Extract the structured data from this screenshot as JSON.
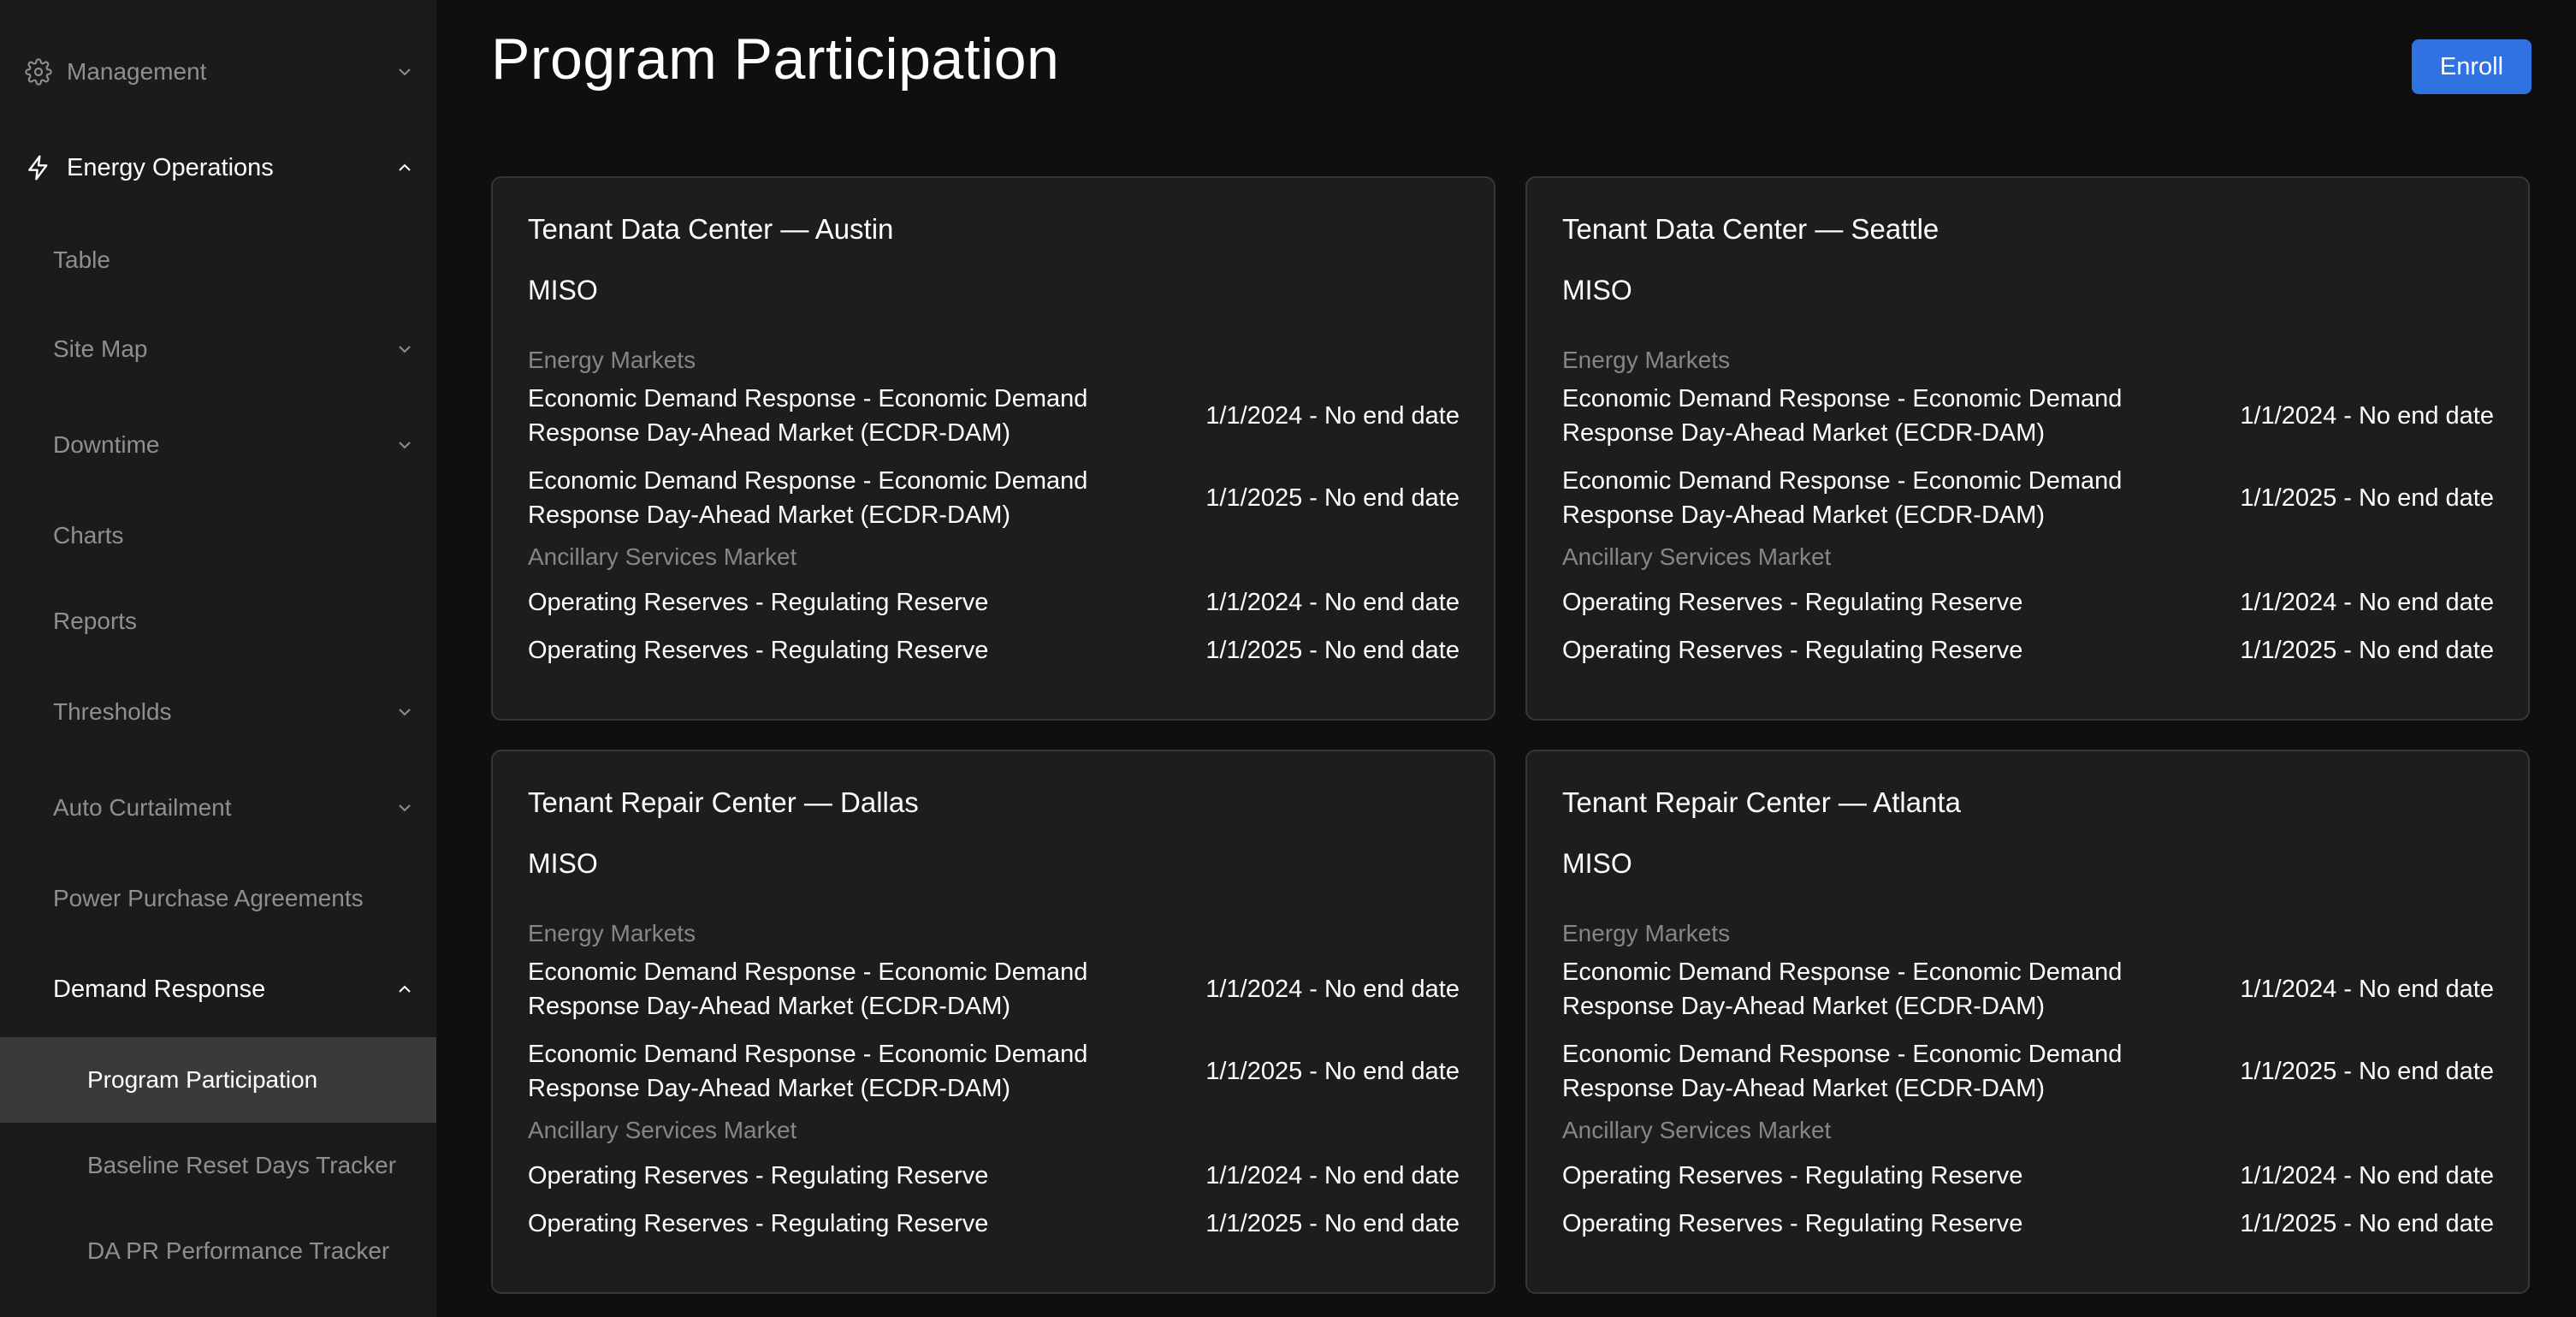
{
  "sidebar": {
    "items": [
      {
        "label": "Management",
        "icon": "gear-icon",
        "chevron": "down"
      },
      {
        "label": "Energy Operations",
        "icon": "lightning-icon",
        "chevron": "up"
      },
      {
        "label": "Table"
      },
      {
        "label": "Site Map",
        "chevron": "down"
      },
      {
        "label": "Downtime",
        "chevron": "down"
      },
      {
        "label": "Charts"
      },
      {
        "label": "Reports"
      },
      {
        "label": "Thresholds",
        "chevron": "down"
      },
      {
        "label": "Auto Curtailment",
        "chevron": "down"
      },
      {
        "label": "Power Purchase Agreements"
      },
      {
        "label": "Demand Response",
        "chevron": "up"
      },
      {
        "label": "Program Participation"
      },
      {
        "label": "Baseline Reset Days Tracker"
      },
      {
        "label": "DA PR Performance Tracker"
      }
    ]
  },
  "header": {
    "title": "Program Participation",
    "enroll_label": "Enroll"
  },
  "cards": [
    {
      "title": "Tenant Data Center — Austin",
      "iso": "MISO",
      "energy_label": "Energy Markets",
      "energy": [
        {
          "program": "Economic Demand Response - Economic Demand Response Day-Ahead Market (ECDR-DAM)",
          "dates": "1/1/2024 - No end date"
        },
        {
          "program": "Economic Demand Response - Economic Demand Response Day-Ahead Market (ECDR-DAM)",
          "dates": "1/1/2025 - No end date"
        }
      ],
      "ancillary_label": "Ancillary Services Market",
      "ancillary": [
        {
          "program": "Operating Reserves - Regulating Reserve",
          "dates": "1/1/2024 - No end date"
        },
        {
          "program": "Operating Reserves - Regulating Reserve",
          "dates": "1/1/2025 - No end date"
        }
      ]
    },
    {
      "title": "Tenant Data Center — Seattle",
      "iso": "MISO",
      "energy_label": "Energy Markets",
      "energy": [
        {
          "program": "Economic Demand Response - Economic Demand Response Day-Ahead Market (ECDR-DAM)",
          "dates": "1/1/2024 - No end date"
        },
        {
          "program": "Economic Demand Response - Economic Demand Response Day-Ahead Market (ECDR-DAM)",
          "dates": "1/1/2025 - No end date"
        }
      ],
      "ancillary_label": "Ancillary Services Market",
      "ancillary": [
        {
          "program": "Operating Reserves - Regulating Reserve",
          "dates": "1/1/2024 - No end date"
        },
        {
          "program": "Operating Reserves - Regulating Reserve",
          "dates": "1/1/2025 - No end date"
        }
      ]
    },
    {
      "title": "Tenant Repair Center — Dallas",
      "iso": "MISO",
      "energy_label": "Energy Markets",
      "energy": [
        {
          "program": "Economic Demand Response - Economic Demand Response Day-Ahead Market (ECDR-DAM)",
          "dates": "1/1/2024 - No end date"
        },
        {
          "program": "Economic Demand Response - Economic Demand Response Day-Ahead Market (ECDR-DAM)",
          "dates": "1/1/2025 - No end date"
        }
      ],
      "ancillary_label": "Ancillary Services Market",
      "ancillary": [
        {
          "program": "Operating Reserves - Regulating Reserve",
          "dates": "1/1/2024 - No end date"
        },
        {
          "program": "Operating Reserves - Regulating Reserve",
          "dates": "1/1/2025 - No end date"
        }
      ]
    },
    {
      "title": "Tenant Repair Center — Atlanta",
      "iso": "MISO",
      "energy_label": "Energy Markets",
      "energy": [
        {
          "program": "Economic Demand Response - Economic Demand Response Day-Ahead Market (ECDR-DAM)",
          "dates": "1/1/2024 - No end date"
        },
        {
          "program": "Economic Demand Response - Economic Demand Response Day-Ahead Market (ECDR-DAM)",
          "dates": "1/1/2025 - No end date"
        }
      ],
      "ancillary_label": "Ancillary Services Market",
      "ancillary": [
        {
          "program": "Operating Reserves - Regulating Reserve",
          "dates": "1/1/2024 - No end date"
        },
        {
          "program": "Operating Reserves - Regulating Reserve",
          "dates": "1/1/2025 - No end date"
        }
      ]
    }
  ],
  "colors": {
    "accent": "#3172e3",
    "sidebar_bg": "#1b1b1b",
    "selected_bg": "#3a3a3a",
    "card_bg": "#1d1d1d",
    "page_bg": "#0f0f0f",
    "muted_text": "#8f8f8f"
  }
}
